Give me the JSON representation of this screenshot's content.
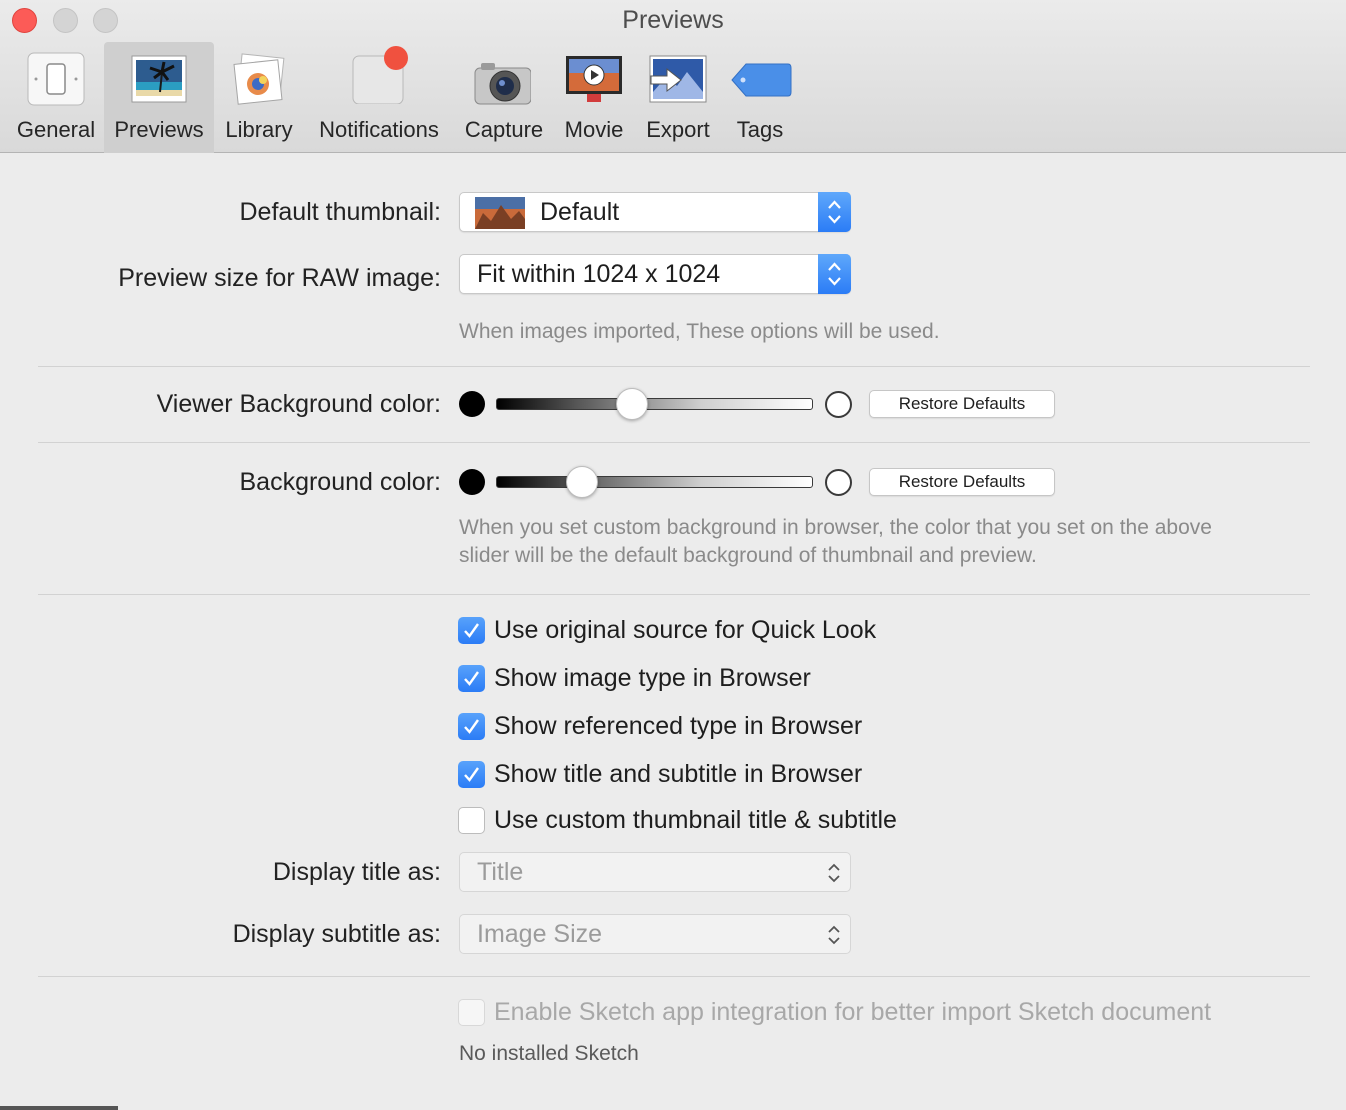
{
  "window": {
    "title": "Previews"
  },
  "toolbar": {
    "items": [
      {
        "label": "General",
        "icon": "light-switch-icon"
      },
      {
        "label": "Previews",
        "icon": "photo-palm-tree-icon",
        "selected": true
      },
      {
        "label": "Library",
        "icon": "photo-library-icon"
      },
      {
        "label": "Notifications",
        "icon": "notification-badge-icon"
      },
      {
        "label": "Capture",
        "icon": "camera-icon"
      },
      {
        "label": "Movie",
        "icon": "movie-play-icon"
      },
      {
        "label": "Export",
        "icon": "export-arrow-icon"
      },
      {
        "label": "Tags",
        "icon": "tag-icon"
      }
    ]
  },
  "form": {
    "default_thumbnail": {
      "label": "Default thumbnail:",
      "value": "Default"
    },
    "raw_preview": {
      "label": "Preview size for RAW image:",
      "value": "Fit within 1024 x 1024"
    },
    "import_hint": "When images imported, These options will be used.",
    "viewer_bg": {
      "label": "Viewer Background color:",
      "level": 0.43,
      "restore_label": "Restore Defaults"
    },
    "bg": {
      "label": "Background color:",
      "level": 0.27,
      "restore_label": "Restore Defaults"
    },
    "bg_hint_line1": "When you set custom background in browser, the color that you set on the above",
    "bg_hint_line2": "slider will be the default background of thumbnail and preview.",
    "checkboxes": [
      {
        "label": "Use original source for Quick Look",
        "checked": true
      },
      {
        "label": "Show image type in Browser",
        "checked": true
      },
      {
        "label": "Show referenced type in Browser",
        "checked": true
      },
      {
        "label": "Show title and subtitle in Browser",
        "checked": true
      },
      {
        "label": "Use custom thumbnail title & subtitle",
        "checked": false
      }
    ],
    "display_title": {
      "label": "Display title as:",
      "value": "Title"
    },
    "display_subtitle": {
      "label": "Display subtitle as:",
      "value": "Image Size"
    },
    "sketch": {
      "label": "Enable Sketch app integration for better import Sketch document",
      "checked": false,
      "enabled": false
    },
    "sketch_status": "No installed Sketch"
  },
  "colors": {
    "accent": "#2b7cf6",
    "close": "#fc5b57",
    "notification_badge": "#f0513f",
    "tag": "#4a8fe8"
  }
}
